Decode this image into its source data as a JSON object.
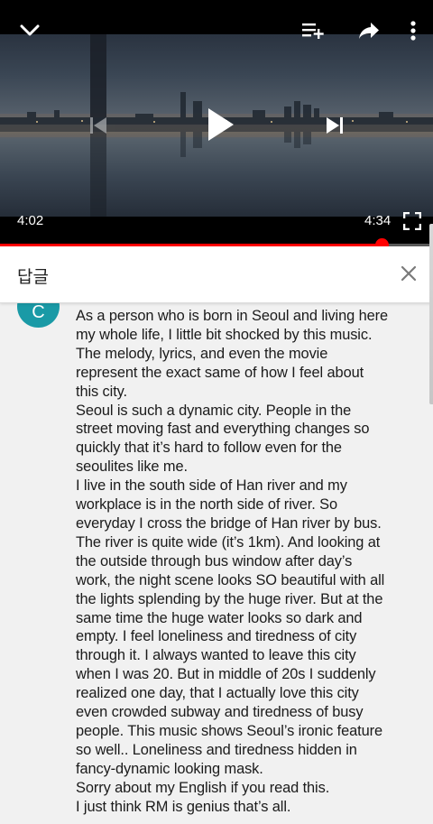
{
  "player": {
    "current_time": "4:02",
    "duration": "4:34",
    "progress_fraction": 0.882,
    "accent_color": "#ff0000",
    "icons": {
      "collapse": "chevron-down-icon",
      "add_to_playlist": "playlist-add-icon",
      "share": "share-icon",
      "more": "more-vert-icon",
      "previous": "skip-previous-icon",
      "play": "play-icon",
      "next": "skip-next-icon",
      "fullscreen": "fullscreen-icon"
    }
  },
  "reply_panel": {
    "title": "답글",
    "close_icon": "close-icon"
  },
  "comment": {
    "avatar_letter": "C",
    "avatar_color": "#1a9aa6",
    "lines": [
      "As a person who is born in Seoul and living here",
      "my whole life, I little bit shocked by this music.",
      "The melody, lyrics, and even the movie",
      "represent the exact same of how I feel about",
      "this city.",
      "Seoul is such a dynamic city. People in the",
      "street moving fast and everything changes so",
      "quickly that it’s hard to follow even for the",
      "seoulites like me.",
      "I live in the south side of Han river and my",
      "workplace is in the north side of river. So",
      "everyday I cross the bridge of Han river by bus.",
      "The river is quite wide (it’s 1km). And looking at",
      "the outside through bus window after day’s",
      "work, the night scene looks SO beautiful with all",
      "the lights splending by the huge river. But at the",
      "same time the huge water looks so dark and",
      "empty. I feel loneliness and tiredness of city",
      "through it. I always wanted to leave this city",
      "when I was 20. But in middle of 20s I suddenly",
      "realized one day, that I actually love this city",
      "even crowded subway and tiredness of busy",
      "people. This music shows Seoul’s ironic feature",
      "so well.. Loneliness and tiredness hidden in",
      "fancy-dynamic looking mask.",
      "Sorry about my English if you read this.",
      "I just think RM is genius that’s all."
    ]
  }
}
